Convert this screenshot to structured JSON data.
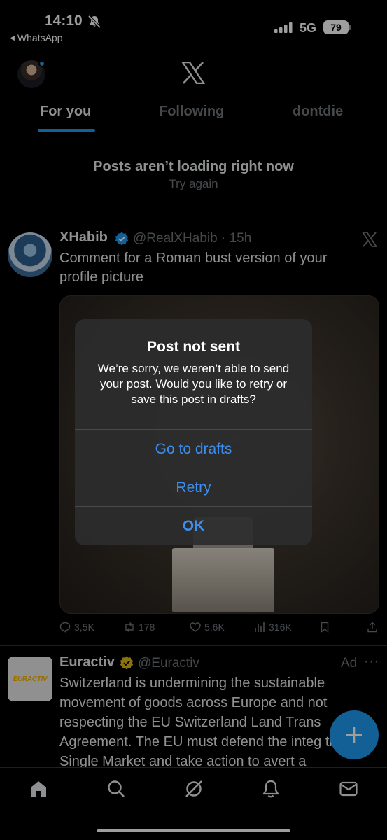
{
  "status_bar": {
    "time": "14:10",
    "back_app": "WhatsApp",
    "network": "5G",
    "battery": "79"
  },
  "tabs": [
    {
      "label": "For you",
      "active": true
    },
    {
      "label": "Following",
      "active": false
    },
    {
      "label": "dontdie",
      "active": false
    }
  ],
  "notice": {
    "title": "Posts aren’t loading right now",
    "action": "Try again"
  },
  "post": {
    "name": "XHabib",
    "handle": "@RealXHabib · 15h",
    "text": "Comment for a Roman bust version of your profile picture",
    "stats": {
      "replies": "3,5K",
      "reposts": "178",
      "likes": "5,6K",
      "views": "316K"
    }
  },
  "ad_post": {
    "avatar_text": "EURACTIV",
    "name": "Euractiv",
    "handle": "@Euractiv",
    "label": "Ad",
    "text": "Switzerland is undermining the sustainable movement of goods across Europe and not respecting the EU Switzerland Land Trans Agreement. The EU must defend the integ the Single Market and take action to avert a"
  },
  "alert": {
    "title": "Post not sent",
    "message": "We’re sorry, we weren’t able to send your post. Would you like to retry or save this post in drafts?",
    "buttons": {
      "drafts": "Go to drafts",
      "retry": "Retry",
      "ok": "OK"
    }
  },
  "colors": {
    "accent": "#1d9bf0",
    "alert_button": "#3b8ff0",
    "muted": "#71767b",
    "gold_badge": "#e2b719"
  },
  "icons": [
    "bell-slash-icon",
    "signal-icon",
    "x-logo-icon",
    "verified-badge-icon",
    "reply-icon",
    "repost-icon",
    "like-icon",
    "views-icon",
    "bookmark-icon",
    "share-icon",
    "compose-plus-icon",
    "home-icon",
    "search-icon",
    "grok-icon",
    "notifications-icon",
    "messages-icon"
  ]
}
